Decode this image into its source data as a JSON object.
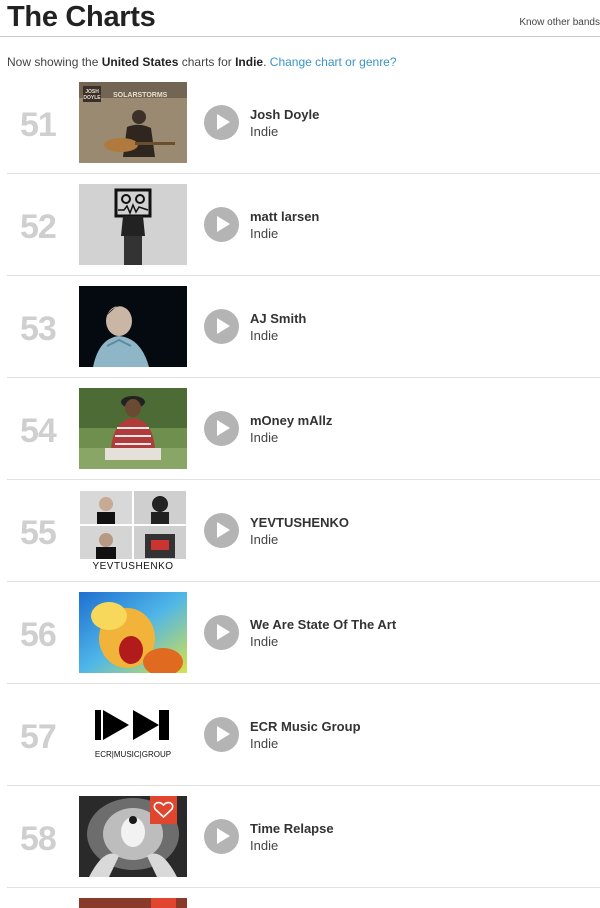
{
  "header": {
    "title": "The Charts",
    "know_other": "Know other bands"
  },
  "subline": {
    "prefix": "Now showing the ",
    "country": "United States",
    "middle": " charts for ",
    "genre": "Indie",
    "dot": ". ",
    "change_link": "Change chart or genre?"
  },
  "rows": [
    {
      "rank": "51",
      "name": "Josh Doyle",
      "genre": "Indie",
      "thumb_text_1": "JOSH",
      "thumb_text_2": "DOYLE",
      "thumb_text_3": "SOLARSTORMS"
    },
    {
      "rank": "52",
      "name": "matt larsen",
      "genre": "Indie"
    },
    {
      "rank": "53",
      "name": "AJ Smith",
      "genre": "Indie"
    },
    {
      "rank": "54",
      "name": "mOney mAllz",
      "genre": "Indie"
    },
    {
      "rank": "55",
      "name": "YEVTUSHENKO",
      "genre": "Indie",
      "thumb_text": "YEVTUSHENKO"
    },
    {
      "rank": "56",
      "name": "We Are State Of The Art",
      "genre": "Indie"
    },
    {
      "rank": "57",
      "name": "ECR Music Group",
      "genre": "Indie",
      "thumb_text": "ECR|MUSIC|GROUP"
    },
    {
      "rank": "58",
      "name": "Time Relapse",
      "genre": "Indie"
    }
  ]
}
